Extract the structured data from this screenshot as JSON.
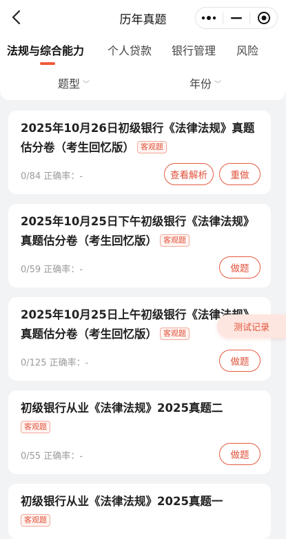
{
  "nav": {
    "title": "历年真题"
  },
  "tabs": [
    "法规与综合能力",
    "个人贷款",
    "银行管理",
    "风险"
  ],
  "filters": {
    "type_label": "题型",
    "year_label": "年份"
  },
  "cards": [
    {
      "title": "2025年10月26日初级银行《法律法规》真题估分卷（考生回忆版）",
      "tag": "客观题",
      "stats": "0/84 正确率：-",
      "buttons": [
        "查看解析",
        "重做"
      ]
    },
    {
      "title": "2025年10月25日下午初级银行《法律法规》真题估分卷（考生回忆版）",
      "tag": "客观题",
      "stats": "0/59 正确率：-",
      "buttons": [
        "做题"
      ]
    },
    {
      "title": "2025年10月25日上午初级银行《法律法规》真题估分卷（考生回忆版）",
      "tag": "客观题",
      "stats": "0/125 正确率：-",
      "buttons": [
        "做题"
      ]
    },
    {
      "title": "初级银行从业《法律法规》2025真题二",
      "tag": "客观题",
      "stats": "0/55 正确率：-",
      "buttons": [
        "做题"
      ]
    },
    {
      "title": "初级银行从业《法律法规》2025真题一",
      "tag": "客观题"
    }
  ],
  "float_button": "测试记录",
  "colors": {
    "accent": "#e0533c",
    "background": "#f2f3f5"
  }
}
